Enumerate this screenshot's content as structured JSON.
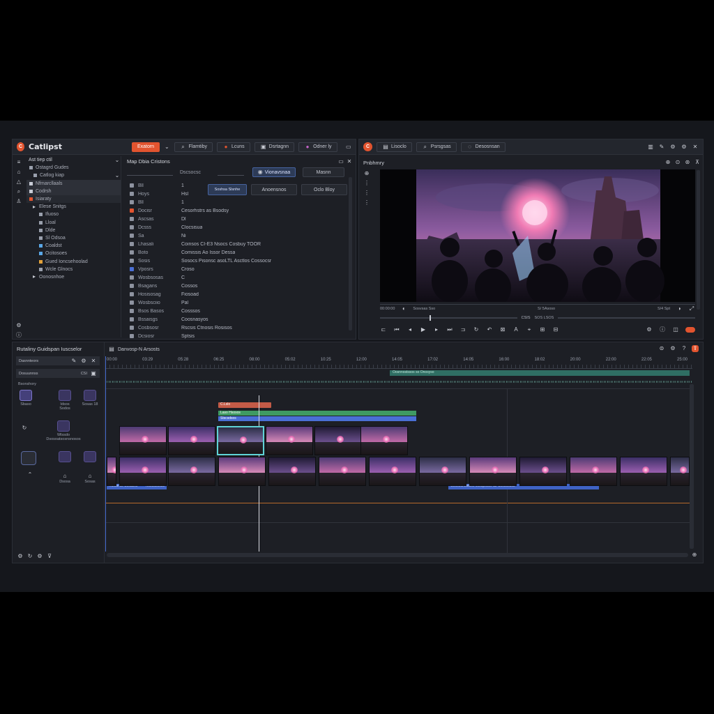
{
  "left_window": {
    "app_name": "Catlipst",
    "tabs": [
      {
        "label": "Exatorn",
        "icon": "export-icon",
        "accent": true
      },
      {
        "label": "Flamtiby",
        "icon": "search-icon"
      },
      {
        "label": "Lcuns",
        "icon": "record-icon"
      },
      {
        "label": "Dsrtagnn",
        "icon": "media-icon"
      },
      {
        "label": "Odner ly",
        "icon": "color-icon"
      }
    ],
    "tree_header": "Ast tiep ctil",
    "tree": [
      "Ostagrd Gudes",
      "Catlog kiap",
      "Nfmarcllaals",
      "Codrsh",
      "Isiaraty",
      "Elese Snitgs",
      "Ifuoso",
      "Lloal",
      "Dlde",
      "Sl Odsoa",
      "Coaldst",
      "Ocitosoes",
      "Gued Ioncsehoolad",
      "Wcle Glnocs",
      "Oonosnhoe"
    ],
    "inspector_title": "Map Dbia Cristons",
    "inspector_buttons": [
      "Vionavsnaa",
      "Masnn",
      "Soshsa Slsnhe",
      "Anoensnos",
      "Oclo Bloy"
    ],
    "properties": [
      {
        "k": "Dcacsas",
        "v": "Dscsocsc"
      },
      {
        "k": "Bll",
        "v": "1"
      },
      {
        "k": "Hoys",
        "v": "Hsl"
      },
      {
        "k": "Bll",
        "v": "1"
      },
      {
        "k": "Docisr",
        "v": "Cesorhstrs as Bsodsy"
      },
      {
        "k": "Ascsas",
        "v": "Dl"
      },
      {
        "k": "Dcsss",
        "v": "Clocsisua"
      },
      {
        "k": "Sa",
        "v": "Ni"
      },
      {
        "k": "Lhasali",
        "v": "Coinsos CI-E3 Nsocs Cosbuy TOOR"
      },
      {
        "k": "Boto",
        "v": "Comissis Ao Issor Dessa"
      },
      {
        "k": "Sosis",
        "v": "Sosocs Pisonsc asoLTL Asctlos Cossocsr"
      },
      {
        "k": "Vposrs",
        "v": "Croso"
      },
      {
        "k": "Wosbsosas",
        "v": "C"
      },
      {
        "k": "Bsagans",
        "v": "Cossos"
      },
      {
        "k": "Hosisosag",
        "v": "Fiosoad"
      },
      {
        "k": "Wosbsciio",
        "v": "Pal"
      },
      {
        "k": "Bsos Basos",
        "v": "Cosssos"
      },
      {
        "k": "Bssaisgs",
        "v": "Coosnasyos"
      },
      {
        "k": "Cosbsosr",
        "v": "Rscsis Ctnosis Rosisos"
      },
      {
        "k": "Dcsiosr",
        "v": "Sptsis"
      }
    ]
  },
  "right_window": {
    "tabs": [
      {
        "label": "Lisoclo",
        "icon": "film-icon"
      },
      {
        "label": "Psrsgsas",
        "icon": "search-icon"
      },
      {
        "label": "Desosnsan",
        "icon": "circle-icon"
      }
    ],
    "viewer_title": "Pnbhmry",
    "timecode_left": "00:00:00",
    "viewer_info": "Sosvsas Sso",
    "center_info": "S/ 5Asoso",
    "right_info": "S/4 Spt",
    "transport_label": "CSIS",
    "transport_label2": "SOS LSOS"
  },
  "timeline": {
    "bins_title": "Rutaliny Guidspan Iuscselor",
    "bin_filter_label": "Dasnnteors",
    "bin_filter2_label": "Dosuunnss",
    "bin_filter2_value": "CSI",
    "bin_section": "Bsonshory",
    "bin_items": [
      "Sbaso",
      "Idsos Sodos",
      "Sosas 18",
      "Wlssdo Dsosoatsosnsnosos",
      "Dsosa",
      "Sosas"
    ],
    "title": "Danvosp-N Arsosts",
    "ruler": [
      "00:00",
      "03:29",
      "05:28",
      "06:25",
      "08:00",
      "05:02",
      "10:25",
      "12:00",
      "14:05",
      "17:02",
      "14:05",
      "16:00",
      "18:02",
      "20:00",
      "22:00",
      "22:05",
      "25:00"
    ],
    "music_track_label": "Oosnnostssos so Onosyso",
    "text_clips": [
      {
        "label": "C.Lslo",
        "color": "#c35b47"
      },
      {
        "label": "Laso Hsosos",
        "color": "#3f9a63"
      },
      {
        "label": "Stscsdsos",
        "color": "#4a6fd6"
      }
    ],
    "subtitle_clips": [
      {
        "label": "Rosos so Sosasos",
        "label2": "Rsosdsosos"
      },
      {
        "label": "Coososmoosos sosoposso as Cosososos"
      }
    ]
  }
}
